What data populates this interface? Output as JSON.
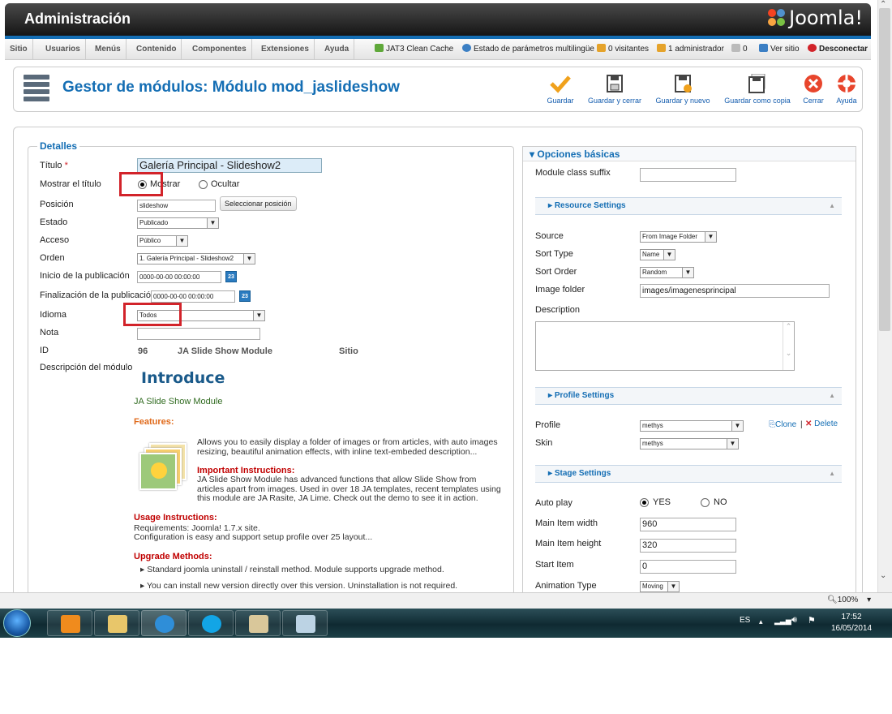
{
  "header": {
    "title": "Administración",
    "brand": "Joomla!"
  },
  "menu": {
    "items": [
      "Sitio",
      "Usuarios",
      "Menús",
      "Contenido",
      "Componentes",
      "Extensiones",
      "Ayuda"
    ],
    "status": {
      "cache": "JAT3 Clean Cache",
      "multilang": "Estado de parámetros multilingüe",
      "visitors": "0 visitantes",
      "admins": "1 administrador",
      "messages": "0",
      "view_site": "Ver sitio",
      "logout": "Desconectar"
    }
  },
  "toolbar": {
    "title": "Gestor de módulos: Módulo mod_jaslideshow",
    "save": "Guardar",
    "save_close": "Guardar y cerrar",
    "save_new": "Guardar y nuevo",
    "save_copy": "Guardar como copia",
    "close": "Cerrar",
    "help": "Ayuda"
  },
  "details": {
    "legend": "Detalles",
    "title_label": "Título",
    "title_value": "Galería Principal - Slideshow2",
    "show_title_label": "Mostrar el título",
    "show_option": "Mostrar",
    "hide_option": "Ocultar",
    "position_label": "Posición",
    "position_value": "slideshow",
    "select_position": "Seleccionar posición",
    "state_label": "Estado",
    "state_value": "Publicado",
    "access_label": "Acceso",
    "access_value": "Público",
    "order_label": "Orden",
    "order_value": "1. Galería Principal - Slideshow2",
    "publish_up_label": "Inicio de la publicación",
    "publish_up_value": "0000-00-00 00:00:00",
    "publish_down_label": "Finalización de la publicación",
    "publish_down_value": "0000-00-00 00:00:00",
    "calendar_day": "23",
    "language_label": "Idioma",
    "language_value": "Todos",
    "note_label": "Nota",
    "id_label": "ID",
    "id_value": "96",
    "module_name": "JA Slide Show Module",
    "client": "Sitio",
    "description_label": "Descripción del módulo"
  },
  "description": {
    "heading": "Introduce",
    "subtitle": "JA Slide Show Module",
    "features": "Features:",
    "features_text": "Allows you to easily display a folder of images or from articles, with auto images resizing, beautiful animation effects, with inline text-embeded description...",
    "important": "Important Instructions:",
    "important_text": "JA Slide Show Module has advanced functions that allow Slide Show from articles apart from images. Used in over 18 JA templates, recent templates using this module are JA Rasite, JA Lime. Check out the demo to see it in action.",
    "usage": "Usage Instructions:",
    "usage_line1": "Requirements: Joomla! 1.7.x site.",
    "usage_line2": "Configuration is easy and support setup profile over 25 layout...",
    "upgrade": "Upgrade Methods:",
    "upgrade_1": "Standard joomla uninstall / reinstall method. Module supports upgrade method.",
    "upgrade_2": "You can install new version directly over this version. Uninstallation is not required."
  },
  "basic": {
    "heading": "Opciones básicas",
    "class_suffix_label": "Module class suffix",
    "resource_settings": "Resource Settings",
    "source_label": "Source",
    "source_value": "From Image Folder",
    "sort_type_label": "Sort Type",
    "sort_type_value": "Name",
    "sort_order_label": "Sort Order",
    "sort_order_value": "Random",
    "image_folder_label": "Image folder",
    "image_folder_value": "images/imagenesprincipal",
    "description_label": "Description",
    "profile_settings": "Profile Settings",
    "profile_label": "Profile",
    "profile_value": "methys",
    "clone": "Clone",
    "delete": "Delete",
    "skin_label": "Skin",
    "skin_value": "methys",
    "stage_settings": "Stage Settings",
    "autoplay_label": "Auto play",
    "yes": "YES",
    "no": "NO",
    "width_label": "Main Item width",
    "width_value": "960",
    "height_label": "Main Item height",
    "height_value": "320",
    "start_label": "Start Item",
    "start_value": "0",
    "animation_label": "Animation Type",
    "animation_value": "Moving"
  },
  "statusbar": {
    "zoom": "100%"
  },
  "taskbar": {
    "lang": "ES",
    "time": "17:52",
    "date": "16/05/2014"
  },
  "colors": {
    "accent": "#146eb4",
    "highlight": "#d2232a",
    "description_heading": "#1a5a8a",
    "features": "#e06a1b",
    "instructions": "#c00000"
  }
}
